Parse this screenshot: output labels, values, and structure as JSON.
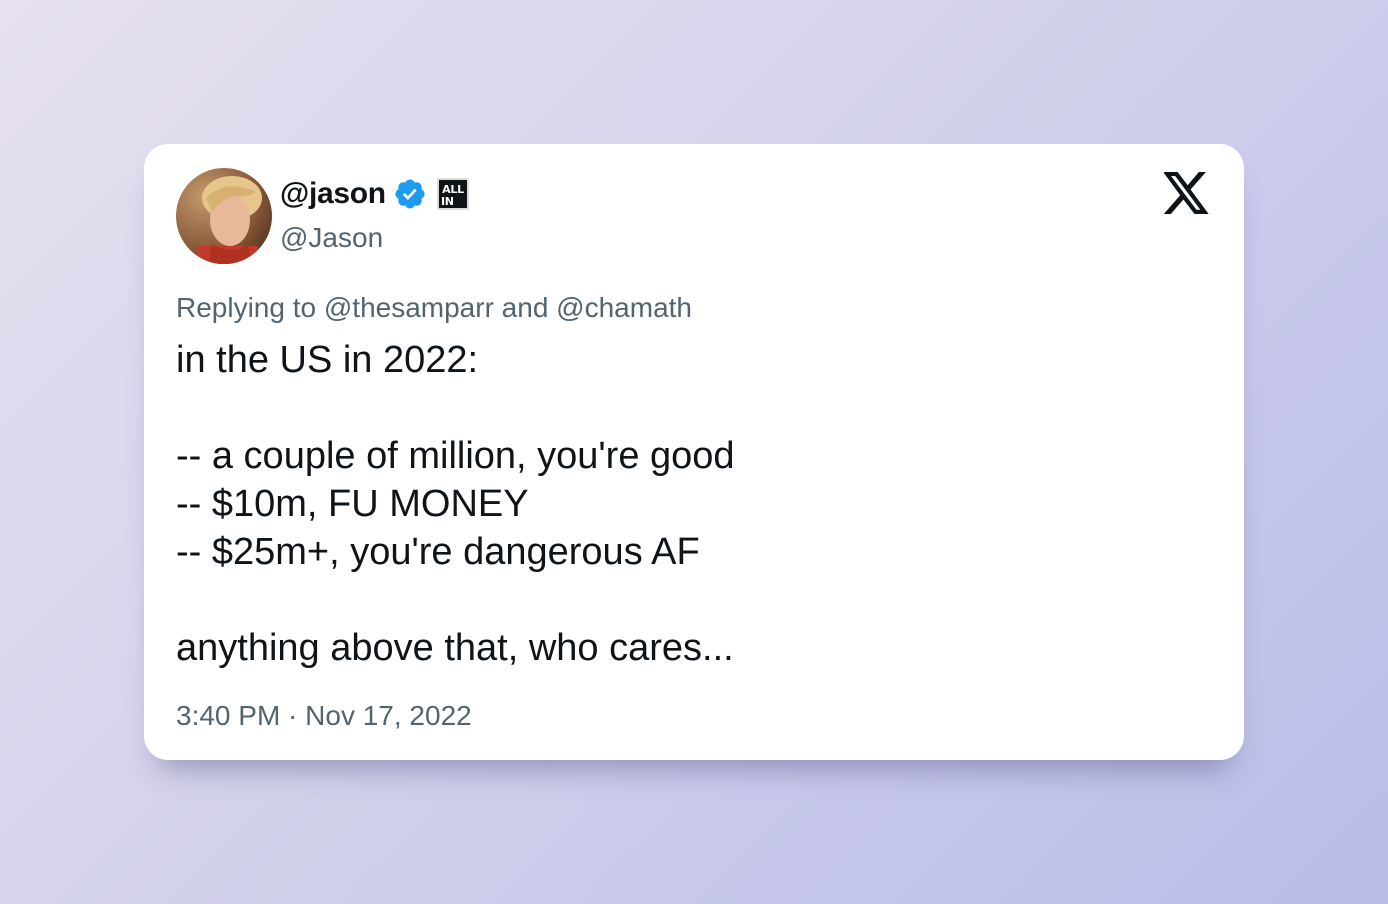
{
  "tweet": {
    "display_name": "@jason",
    "handle": "@Jason",
    "verified_icon": "verified-badge-icon",
    "affiliate_badge": {
      "icon": "all-in-badge-icon",
      "line1": "ALL",
      "line2": "IN"
    },
    "platform_icon": "x-logo-icon",
    "reply_line": "Replying to @thesamparr and @chamath",
    "body_lines": [
      "in the US in 2022:",
      "",
      "-- a couple of million, you're good",
      "-- $10m, FU MONEY",
      "-- $25m+, you're dangerous AF",
      "",
      "anything above that, who cares..."
    ],
    "timestamp": "3:40 PM · Nov 17, 2022"
  },
  "colors": {
    "verified_blue": "#1d9bf0",
    "text_primary": "#0f1419",
    "text_secondary": "#536471"
  }
}
